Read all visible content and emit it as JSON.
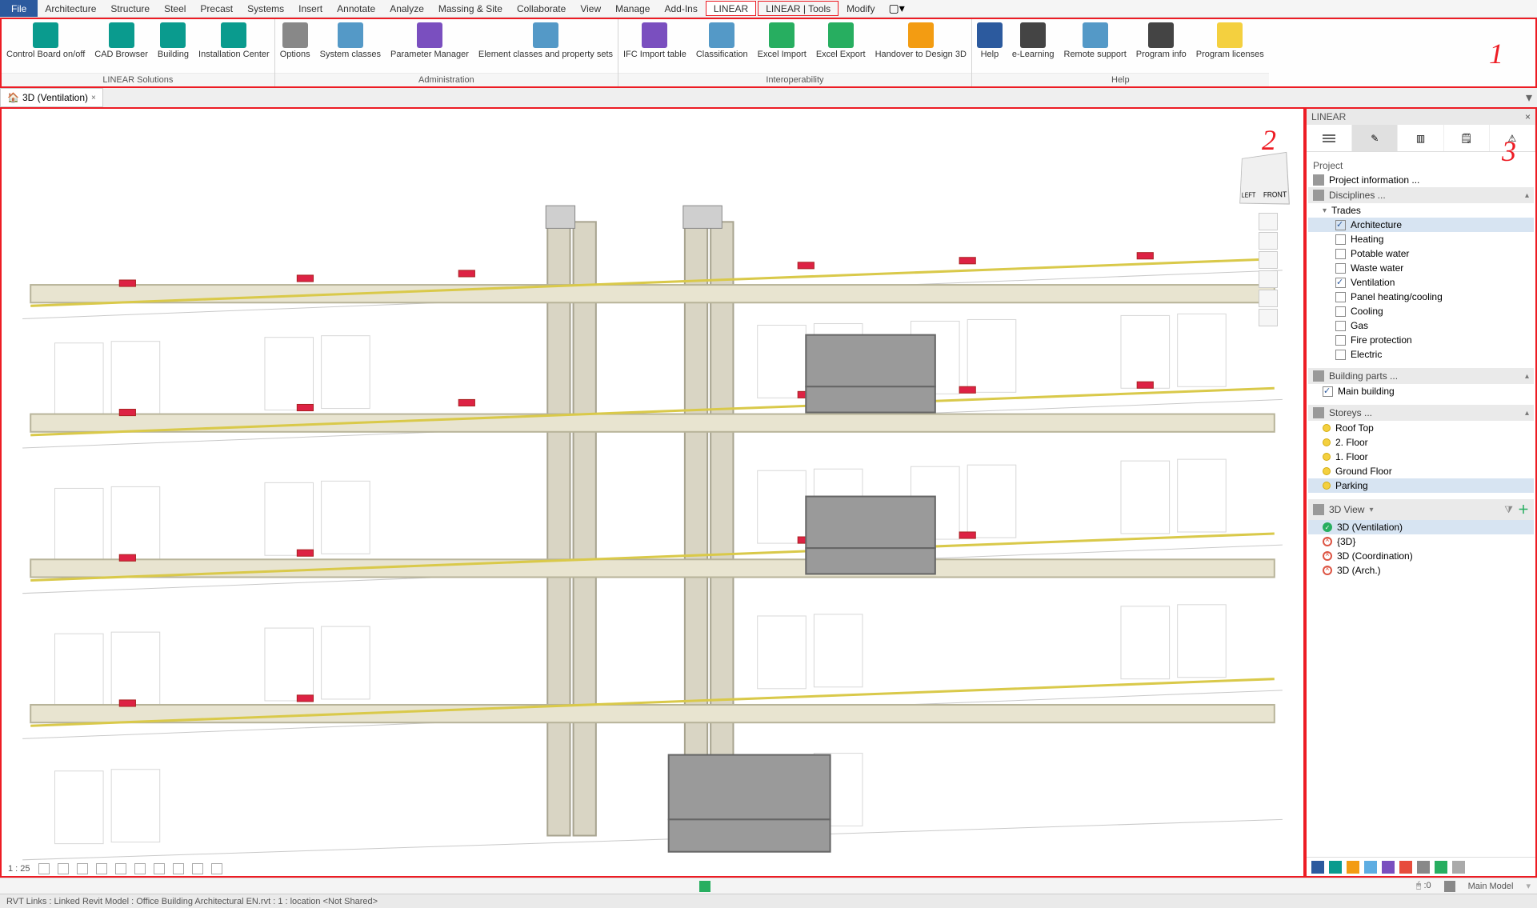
{
  "menubar": {
    "file": "File",
    "items": [
      "Architecture",
      "Structure",
      "Steel",
      "Precast",
      "Systems",
      "Insert",
      "Annotate",
      "Analyze",
      "Massing & Site",
      "Collaborate",
      "View",
      "Manage",
      "Add-Ins",
      "LINEAR",
      "LINEAR | Tools",
      "Modify"
    ],
    "active_index": 13,
    "boxed_indices": [
      13,
      14
    ],
    "extra_glyph": "▢▾"
  },
  "annotations": {
    "ribbon": "1",
    "viewport": "2",
    "panel": "3"
  },
  "ribbon": {
    "groups": [
      {
        "title": "LINEAR Solutions",
        "buttons": [
          {
            "label": "Control Board on/off",
            "icon": "ic-teal"
          },
          {
            "label": "CAD Browser",
            "icon": "ic-teal"
          },
          {
            "label": "Building",
            "icon": "ic-teal"
          },
          {
            "label": "Installation Center",
            "icon": "ic-teal"
          }
        ]
      },
      {
        "title": "Administration",
        "buttons": [
          {
            "label": "Options",
            "icon": "ic-grey"
          },
          {
            "label": "System classes",
            "icon": "ic-lblue"
          },
          {
            "label": "Parameter Manager",
            "icon": "ic-violet"
          },
          {
            "label": "Element classes and property sets",
            "icon": "ic-lblue"
          }
        ]
      },
      {
        "title": "Interoperability",
        "buttons": [
          {
            "label": "IFC Import table",
            "icon": "ic-violet"
          },
          {
            "label": "Classification",
            "icon": "ic-lblue"
          },
          {
            "label": "Excel Import",
            "icon": "ic-green"
          },
          {
            "label": "Excel Export",
            "icon": "ic-green"
          },
          {
            "label": "Handover to Design 3D",
            "icon": "ic-orange"
          }
        ]
      },
      {
        "title": "Help",
        "buttons": [
          {
            "label": "Help",
            "icon": "ic-blue"
          },
          {
            "label": "e-Learning",
            "icon": "ic-dark"
          },
          {
            "label": "Remote support",
            "icon": "ic-lblue"
          },
          {
            "label": "Program info",
            "icon": "ic-dark"
          },
          {
            "label": "Program licenses",
            "icon": "ic-yellow"
          }
        ]
      }
    ]
  },
  "viewtab": {
    "name": "3D (Ventilation)",
    "close": "×"
  },
  "navcube": {
    "left": "LEFT",
    "front": "FRONT"
  },
  "viewcontrol": {
    "scale": "1 : 25",
    "icons": 9
  },
  "panel": {
    "title": "LINEAR",
    "section_project": "Project",
    "project_info": "Project information ...",
    "disciplines": "Disciplines ...",
    "trades_hdr": "Trades",
    "trades": [
      {
        "label": "Architecture",
        "checked": true,
        "sel": true
      },
      {
        "label": "Heating",
        "checked": false
      },
      {
        "label": "Potable water",
        "checked": false
      },
      {
        "label": "Waste water",
        "checked": false
      },
      {
        "label": "Ventilation",
        "checked": true
      },
      {
        "label": "Panel heating/cooling",
        "checked": false
      },
      {
        "label": "Cooling",
        "checked": false
      },
      {
        "label": "Gas",
        "checked": false
      },
      {
        "label": "Fire protection",
        "checked": false
      },
      {
        "label": "Electric",
        "checked": false
      }
    ],
    "building_parts": "Building parts ...",
    "main_building": "Main building",
    "storeys": "Storeys ...",
    "storey_list": [
      "Roof Top",
      "2. Floor",
      "1. Floor",
      "Ground Floor",
      "Parking"
    ],
    "storey_sel_index": 4,
    "view_header": "3D View",
    "views": [
      {
        "label": "3D (Ventilation)",
        "ok": true,
        "sel": true
      },
      {
        "label": "{3D}",
        "ok": false
      },
      {
        "label": "3D (Coordination)",
        "ok": false
      },
      {
        "label": "3D (Arch.)",
        "ok": false
      }
    ]
  },
  "optionbar": {
    "promptA": ":0",
    "model": "Main Model"
  },
  "statusbar": {
    "text": "RVT Links : Linked Revit Model : Office Building Architectural EN.rvt : 1 : location <Not Shared>"
  }
}
